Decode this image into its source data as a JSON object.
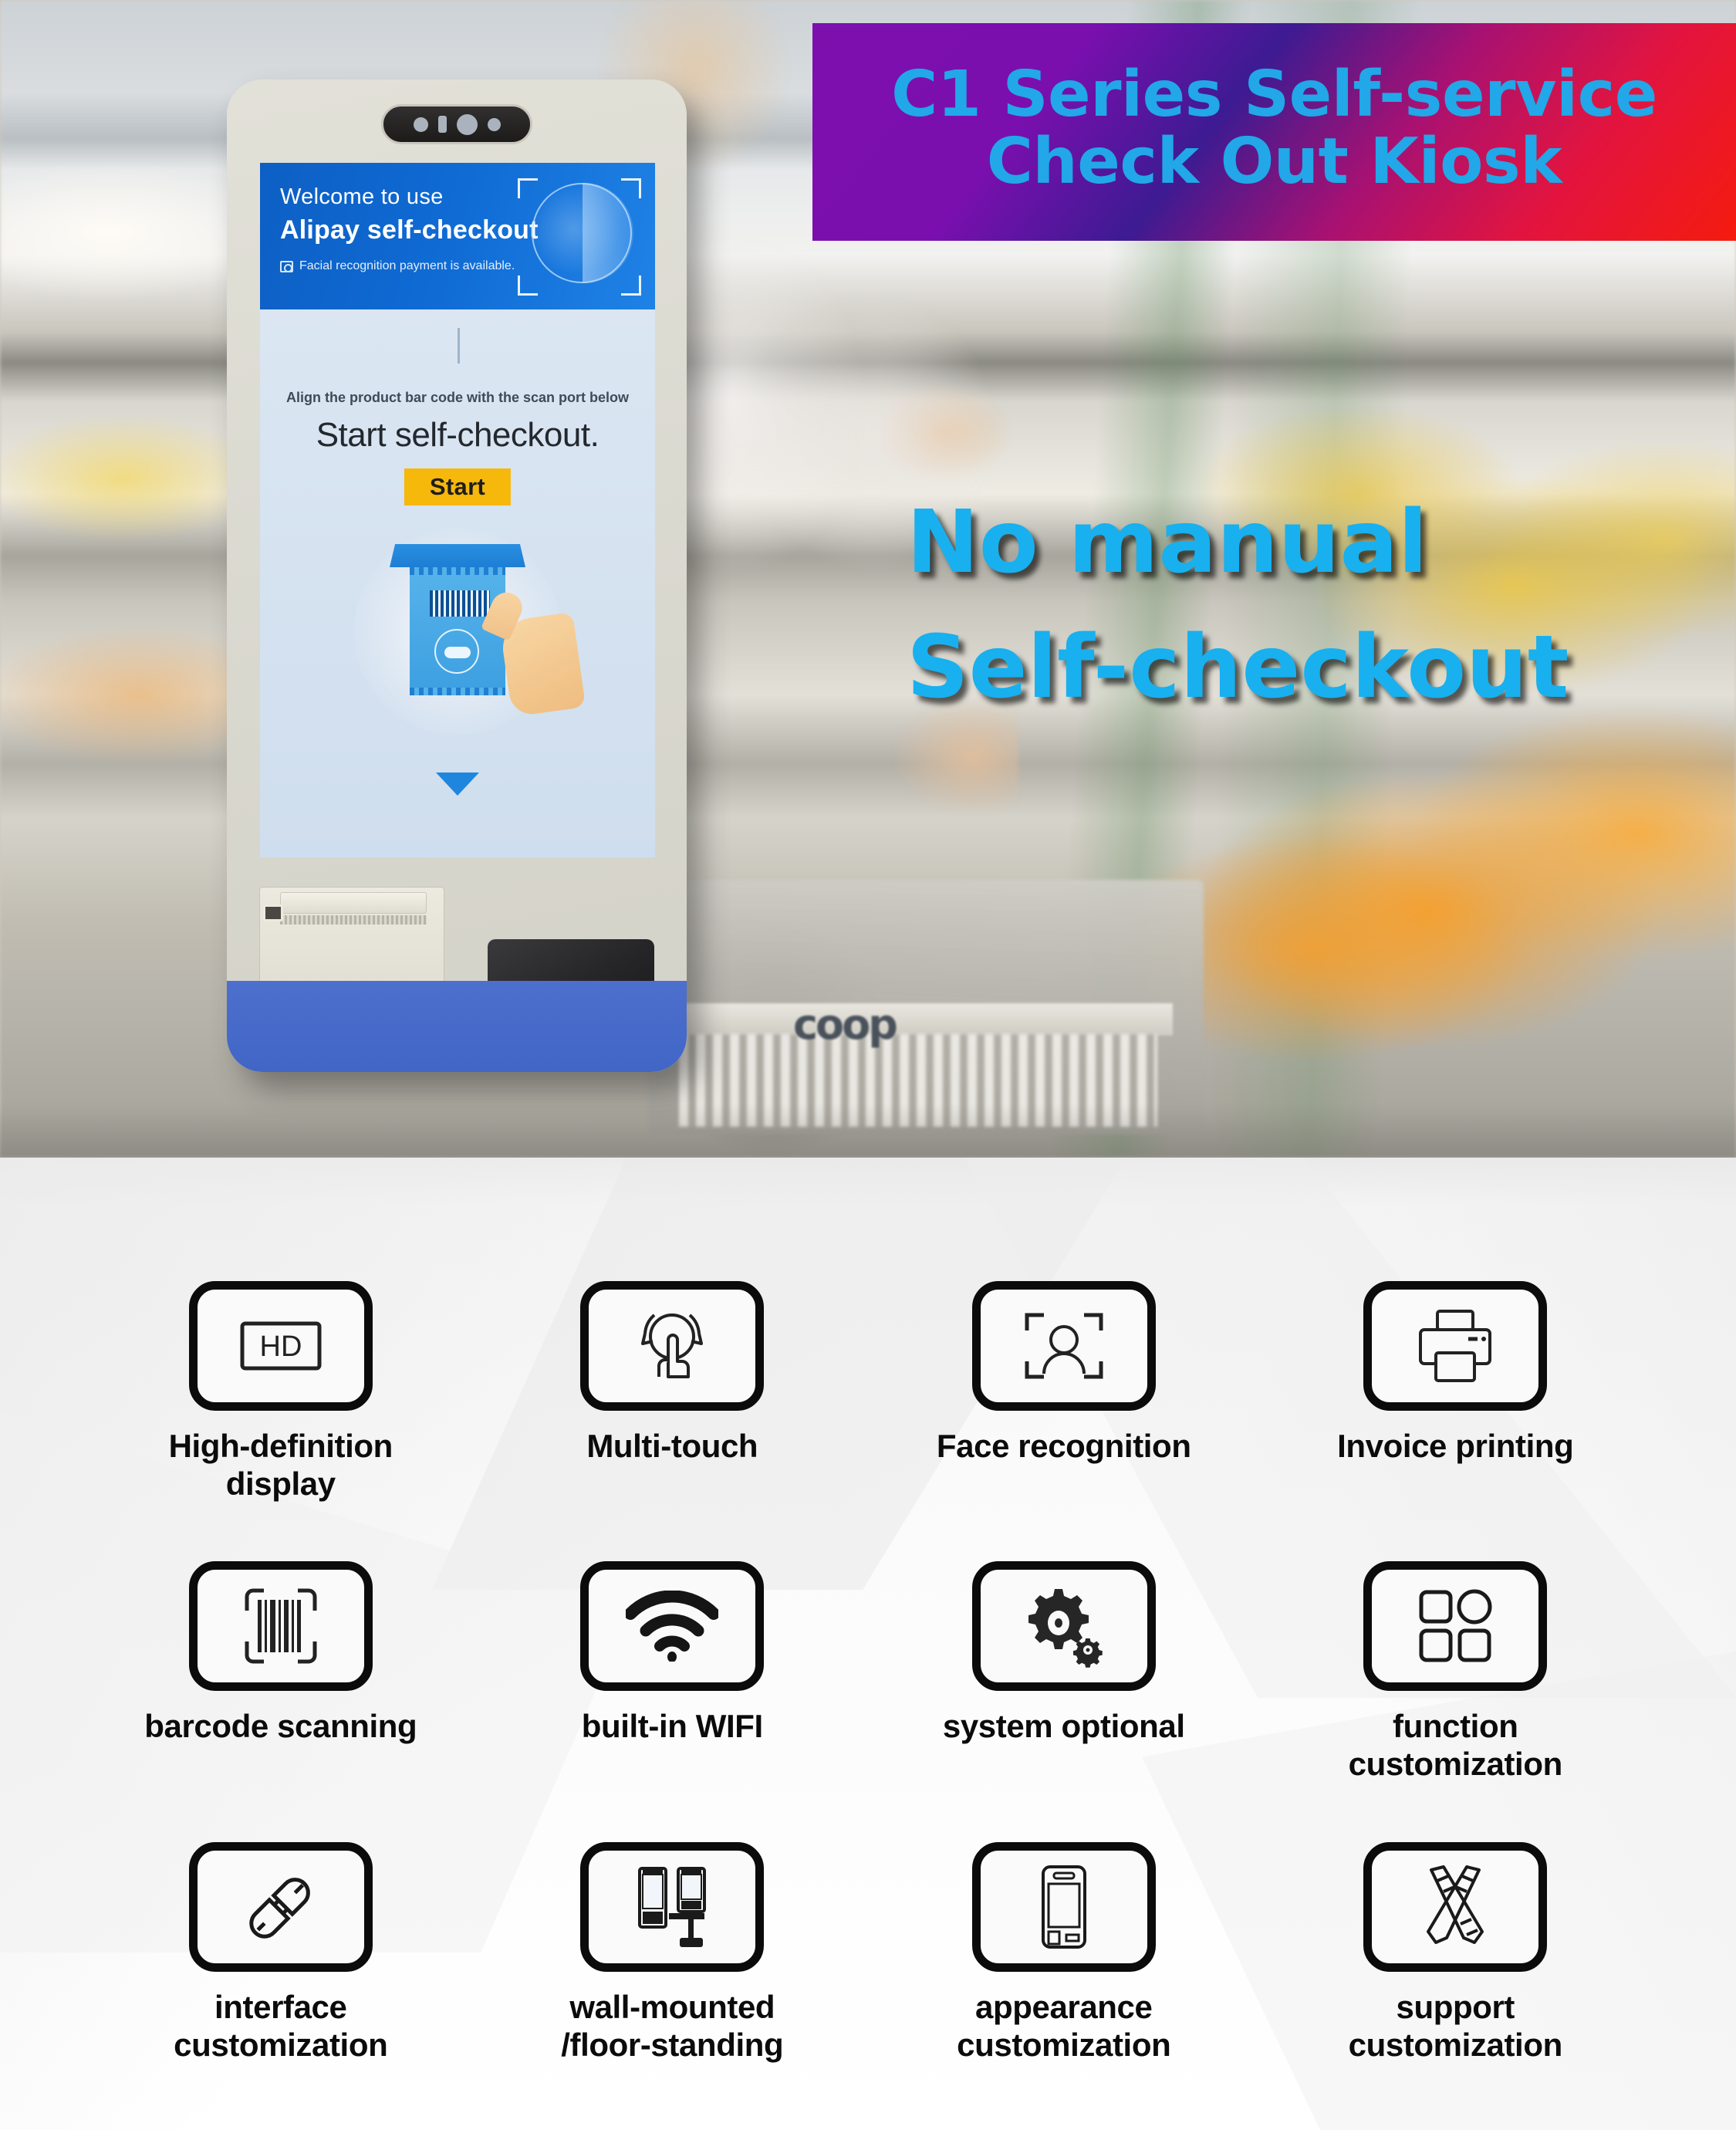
{
  "banner": {
    "line1": "C1 Series Self-service",
    "line2": "Check Out Kiosk",
    "text_color": "#22a7e8",
    "gradient_from": "#7d0fad",
    "gradient_to": "#f51b0e"
  },
  "slogan": {
    "line1": "No manual",
    "line2": "Self-checkout",
    "color": "#18b0ef"
  },
  "photo": {
    "cart_brand": "coop"
  },
  "kiosk": {
    "screen": {
      "header": {
        "welcome_line": "Welcome to use",
        "app_line": "Alipay self-checkout",
        "note": "Facial recognition payment is available.",
        "bg_color": "#0f6ad3"
      },
      "body": {
        "hint": "Align the product bar code with the scan port below",
        "headline": "Start self-checkout.",
        "start_button": "Start",
        "start_button_color": "#f6b80b"
      }
    },
    "hardware": {
      "camera": "camera-module",
      "printer": "receipt-printer",
      "scanner": "barcode-scanner-window",
      "base_color": "#4166c6"
    }
  },
  "features": [
    {
      "icon": "hd-display-icon",
      "label": "High-definition\ndisplay"
    },
    {
      "icon": "multi-touch-icon",
      "label": "Multi-touch"
    },
    {
      "icon": "face-recognition-icon",
      "label": "Face recognition"
    },
    {
      "icon": "printer-icon",
      "label": "Invoice printing"
    },
    {
      "icon": "barcode-icon",
      "label": "barcode scanning"
    },
    {
      "icon": "wifi-icon",
      "label": "built-in WIFI"
    },
    {
      "icon": "gears-icon",
      "label": "system optional"
    },
    {
      "icon": "app-grid-icon",
      "label": "function\ncustomization"
    },
    {
      "icon": "plug-connector-icon",
      "label": "interface\ncustomization"
    },
    {
      "icon": "wall-floor-mount-icon",
      "label": "wall-mounted\n/floor-standing"
    },
    {
      "icon": "device-outline-icon",
      "label": "appearance\ncustomization"
    },
    {
      "icon": "crossed-tools-icon",
      "label": "support\ncustomization"
    }
  ]
}
